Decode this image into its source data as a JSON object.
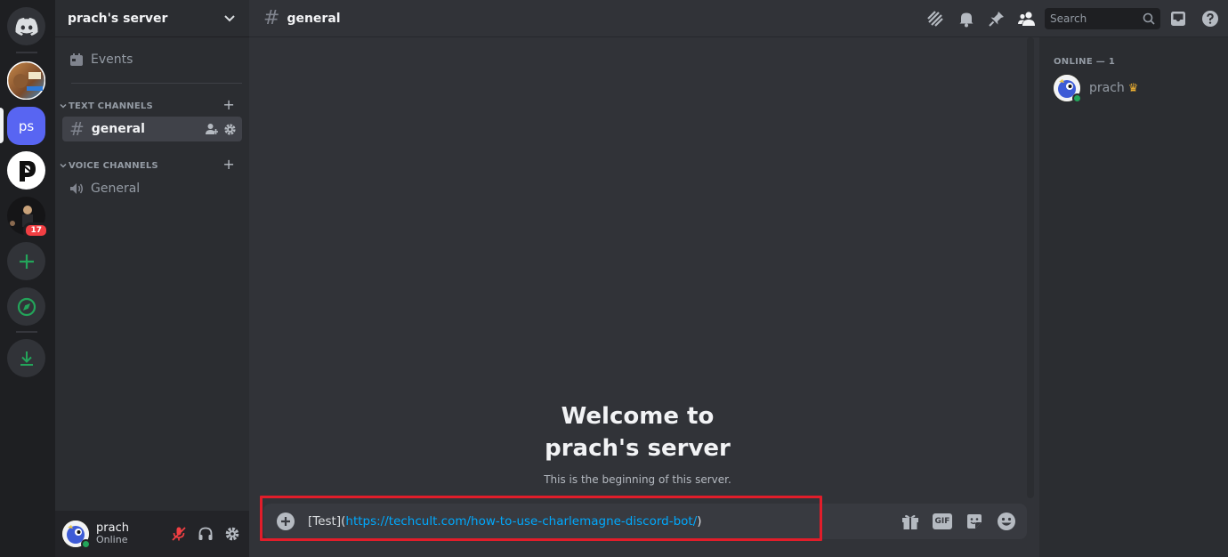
{
  "server_rail": {
    "home_icon": "discord-logo-icon",
    "selected_server_initials": "ps",
    "badge_count": "17",
    "add_icon": "plus-icon",
    "explore_icon": "compass-icon",
    "download_icon": "download-icon"
  },
  "sidebar": {
    "server_name": "prach's server",
    "events_label": "Events",
    "text_category": "TEXT CHANNELS",
    "voice_category": "VOICE CHANNELS",
    "text_channels": [
      {
        "label": "general"
      }
    ],
    "voice_channels": [
      {
        "label": "General"
      }
    ]
  },
  "user_panel": {
    "name": "prach",
    "status": "Online"
  },
  "topbar": {
    "channel_name": "general",
    "search_placeholder": "Search"
  },
  "main": {
    "welcome_line1": "Welcome to",
    "welcome_line2": "prach's server",
    "welcome_sub": "This is the beginning of this server."
  },
  "composer": {
    "text_prefix": "[Test](",
    "link": "https://techcult.com/how-to-use-charlemagne-discord-bot/",
    "text_suffix": ")",
    "gif_label": "GIF"
  },
  "members": {
    "header": "ONLINE — 1",
    "list": [
      {
        "name": "prach",
        "crown": "♛"
      }
    ]
  },
  "colors": {
    "accent": "#5865f2",
    "online": "#23a55a",
    "link": "#00a8fc",
    "highlight_box": "#e11d2a",
    "badge": "#f23f43"
  }
}
